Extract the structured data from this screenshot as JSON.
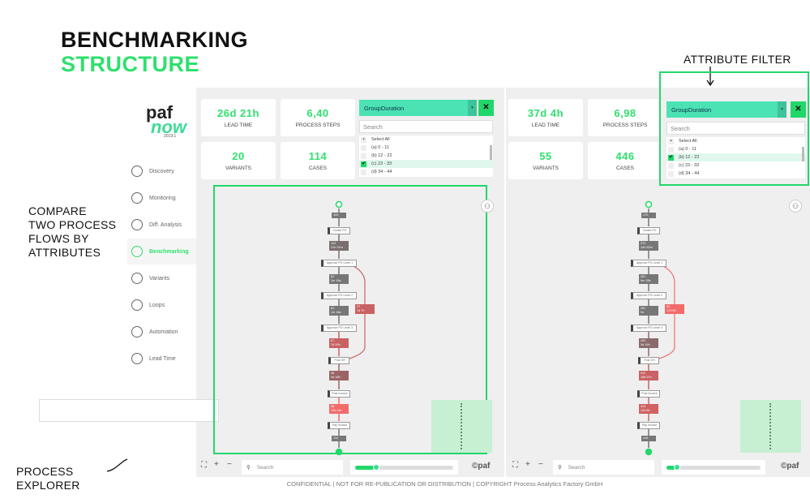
{
  "slide": {
    "title_line1": "BENCHMARKING",
    "title_line2": "STRUCTURE",
    "attribute_filter_label": "ATTRIBUTE FILTER",
    "compare_label": "COMPARE\nTWO PROCESS\nFLOWS BY\nATTRIBUTES",
    "process_explorer_label": "PROCESS\nEXPLORER",
    "footer": "CONFIDENTIAL | NOT FOR RE-PUBLICATION OR DISTRIBUTION | COPYRIGHT Process Analytics Factory GmbH"
  },
  "app": {
    "logo_top": "paf",
    "logo_bottom": "now",
    "version": "2019.1",
    "nav": [
      {
        "label": "Discovery",
        "icon": "compass-icon"
      },
      {
        "label": "Monitoring",
        "icon": "monitor-chart-icon"
      },
      {
        "label": "Diff. Analysis",
        "icon": "pie-chart-icon"
      },
      {
        "label": "Benchmarking",
        "icon": "benchmark-icon",
        "active": true
      },
      {
        "label": "Variants",
        "icon": "variants-icon"
      },
      {
        "label": "Loops",
        "icon": "loop-icon"
      },
      {
        "label": "Automation",
        "icon": "gear-icon"
      },
      {
        "label": "Lead Time",
        "icon": "clock-icon"
      }
    ]
  },
  "colors": {
    "accent": "#2fe06e",
    "dropdown": "#4be2b4",
    "edge_gray": "#777777",
    "edge_darkred": "#9c6464",
    "edge_red": "#c96262",
    "edge_brightred": "#f26b6b"
  },
  "panels": [
    {
      "kpis": [
        {
          "value": "26d 21h",
          "label": "LEAD TIME"
        },
        {
          "value": "6,40",
          "label": "PROCESS STEPS"
        },
        {
          "value": "20",
          "label": "VARIANTS"
        },
        {
          "value": "114",
          "label": "CASES"
        }
      ],
      "filter": {
        "selected": "GroupDuration",
        "search_placeholder": "Search",
        "close": "✕",
        "options": [
          {
            "label": "Select All"
          },
          {
            "label": "(a) 0 - 11"
          },
          {
            "label": "(b) 12 - 22"
          },
          {
            "label": "(c) 23 - 33",
            "checked": true
          },
          {
            "label": "(d) 34 - 44"
          }
        ]
      },
      "flow": {
        "activities": [
          "Create PO",
          "Approve PO Level 1",
          "Approve PO Level 2",
          "Approve PO Level 3",
          "Post GR",
          "Post Invoice",
          "Pay Invoice"
        ],
        "edges": [
          {
            "count": "104",
            "color": "#777777"
          },
          {
            "count": "102",
            "time": "21h 31m",
            "color": "#7a6f6f"
          },
          {
            "count": "62",
            "time": "2m 16s",
            "color": "#777777"
          },
          {
            "count": "62",
            "time": "1m 16s",
            "color": "#777777"
          },
          {
            "count": "67",
            "time": "7d 20h",
            "color": "#c96262"
          },
          {
            "count": "98",
            "time": "4d 18h",
            "color": "#9c6464"
          },
          {
            "count": "98",
            "time": "13d 11h",
            "color": "#f26b6b"
          },
          {
            "count": "112",
            "color": "#777777"
          }
        ],
        "bypass": {
          "count": "27",
          "time": "7d 7h",
          "color": "#c96262"
        }
      },
      "toolbar": {
        "search_placeholder": "Search",
        "slider": 0.15,
        "brand": "©paf"
      }
    },
    {
      "kpis": [
        {
          "value": "37d 4h",
          "label": "LEAD TIME"
        },
        {
          "value": "6,98",
          "label": "PROCESS STEPS"
        },
        {
          "value": "55",
          "label": "VARIANTS"
        },
        {
          "value": "446",
          "label": "CASES"
        }
      ],
      "filter": {
        "selected": "GroupDuration",
        "search_placeholder": "Search",
        "close": "✕",
        "options": [
          {
            "label": "Select All"
          },
          {
            "label": "(a) 0 - 11"
          },
          {
            "label": "(b) 12 - 22",
            "checked": true
          },
          {
            "label": "(c) 23 - 33"
          },
          {
            "label": "(d) 34 - 44"
          }
        ]
      },
      "flow": {
        "activities": [
          "Create PO",
          "Approve PO Level 1",
          "Approve PO Level 2",
          "Approve PO Level 3",
          "Post GR",
          "Post Invoice",
          "Pay Invoice"
        ],
        "edges": [
          {
            "count": "170",
            "color": "#777777"
          },
          {
            "count": "372",
            "time": "14h 53m",
            "color": "#777777"
          },
          {
            "count": "261",
            "time": "9m 33s",
            "color": "#777777"
          },
          {
            "count": "261",
            "time": "9s",
            "color": "#777777"
          },
          {
            "count": "263",
            "time": "3d 19h",
            "color": "#8a6a6a"
          },
          {
            "count": "411",
            "time": "18d 21h",
            "color": "#c96262"
          },
          {
            "count": "414",
            "time": "12d 5h",
            "color": "#d06262"
          },
          {
            "count": "418",
            "color": "#777777"
          }
        ],
        "bypass": {
          "count": "80",
          "time": "17d 5h",
          "color": "#f26b6b"
        }
      },
      "toolbar": {
        "search_placeholder": "Search",
        "slider": 0.05,
        "brand": "©paf"
      }
    }
  ]
}
